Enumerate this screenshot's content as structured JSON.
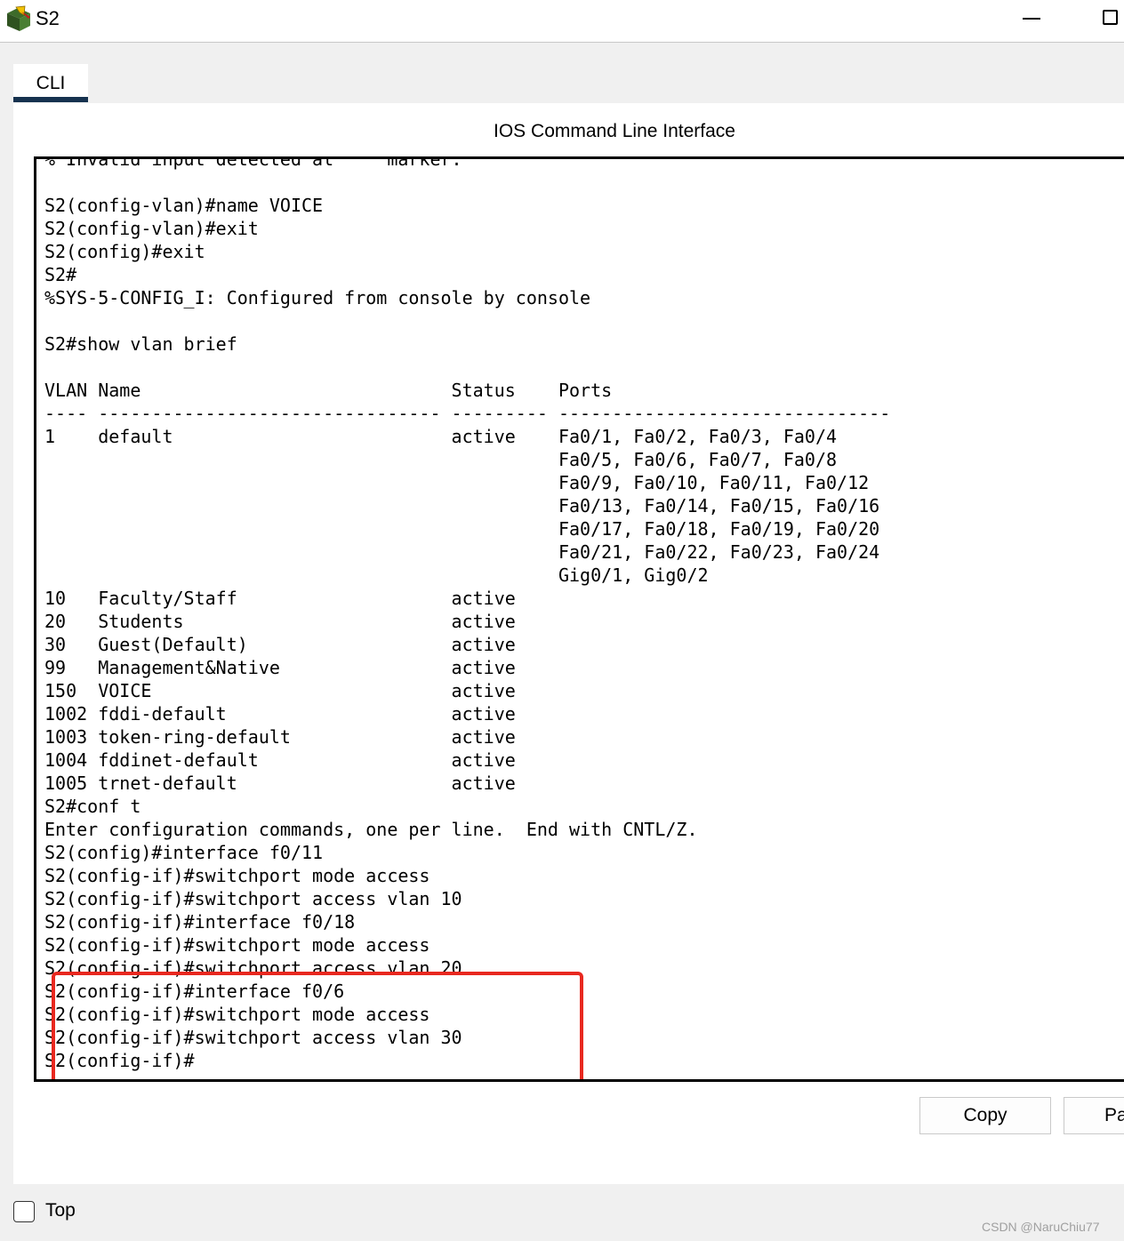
{
  "window": {
    "title": "S2",
    "icon": "packet-tracer-switch-icon"
  },
  "tabs": [
    {
      "label": "CLI"
    }
  ],
  "cli": {
    "heading": "IOS Command Line Interface",
    "lines": [
      "% Invalid input detected at '^' marker.",
      "",
      "S2(config-vlan)#name VOICE",
      "S2(config-vlan)#exit",
      "S2(config)#exit",
      "S2#",
      "%SYS-5-CONFIG_I: Configured from console by console",
      "",
      "S2#show vlan brief",
      "",
      "VLAN Name                             Status    Ports",
      "---- -------------------------------- --------- -------------------------------",
      "1    default                          active    Fa0/1, Fa0/2, Fa0/3, Fa0/4",
      "                                                Fa0/5, Fa0/6, Fa0/7, Fa0/8",
      "                                                Fa0/9, Fa0/10, Fa0/11, Fa0/12",
      "                                                Fa0/13, Fa0/14, Fa0/15, Fa0/16",
      "                                                Fa0/17, Fa0/18, Fa0/19, Fa0/20",
      "                                                Fa0/21, Fa0/22, Fa0/23, Fa0/24",
      "                                                Gig0/1, Gig0/2",
      "10   Faculty/Staff                    active    ",
      "20   Students                         active    ",
      "30   Guest(Default)                   active    ",
      "99   Management&Native                active    ",
      "150  VOICE                            active    ",
      "1002 fddi-default                     active    ",
      "1003 token-ring-default               active    ",
      "1004 fddinet-default                  active    ",
      "1005 trnet-default                    active    ",
      "S2#conf t",
      "Enter configuration commands, one per line.  End with CNTL/Z.",
      "S2(config)#interface f0/11",
      "S2(config-if)#switchport mode access",
      "S2(config-if)#switchport access vlan 10",
      "S2(config-if)#interface f0/18",
      "S2(config-if)#switchport mode access",
      "S2(config-if)#switchport access vlan 20",
      "S2(config-if)#interface f0/6",
      "S2(config-if)#switchport mode access",
      "S2(config-if)#switchport access vlan 30",
      "S2(config-if)#"
    ],
    "highlight_color": "#e8281f"
  },
  "buttons": {
    "copy_label": "Copy",
    "paste_label": "Paste"
  },
  "footer": {
    "top_label": "Top",
    "top_checked": false
  },
  "watermark": "CSDN @NaruChiu77",
  "colors": {
    "tab_underline": "#16324f",
    "highlight": "#e8281f"
  }
}
